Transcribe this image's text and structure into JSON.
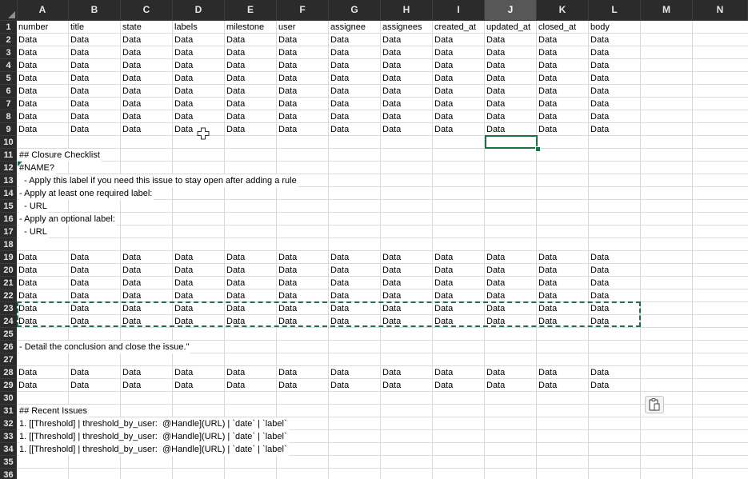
{
  "spreadsheet": {
    "columns": [
      "A",
      "B",
      "C",
      "D",
      "E",
      "F",
      "G",
      "H",
      "I",
      "J",
      "K",
      "L",
      "M",
      "N"
    ],
    "selected_column": "J",
    "selected_cell": "J10",
    "rows": [
      "1",
      "2",
      "3",
      "4",
      "5",
      "6",
      "7",
      "8",
      "9",
      "10",
      "11",
      "12",
      "13",
      "14",
      "15",
      "16",
      "17",
      "18",
      "19",
      "20",
      "21",
      "22",
      "23",
      "24",
      "25",
      "26",
      "27",
      "28",
      "29",
      "30",
      "31",
      "32",
      "33",
      "34",
      "35",
      "36"
    ],
    "headers": [
      "number",
      "title",
      "state",
      "labels",
      "milestone",
      "user",
      "assignee",
      "assignees",
      "created_at",
      "updated_at",
      "closed_at",
      "body"
    ],
    "data_cell": "Data",
    "notes": {
      "r11": "## Closure Checklist",
      "r12": "#NAME?",
      "r13": "  - Apply this label if you need this issue to stay open after adding a rule",
      "r14": "- Apply at least one required label:",
      "r15": "  - URL",
      "r16": "- Apply an optional label:",
      "r17": "  - URL",
      "r26": "- Detail the conclusion and close the issue.\"",
      "r31": "## Recent Issues",
      "r32": "1. [[Threshold] | threshold_by_user:  @Handle](URL) | `date` | `label`",
      "r33": "1. [[Threshold] | threshold_by_user:  @Handle](URL) | `date` | `label`",
      "r34": "1. [[Threshold] | threshold_by_user:  @Handle](URL) | `date` | `label`"
    },
    "icons": {
      "paste_options": "clipboard-icon",
      "cursor": "cell-cursor-icon",
      "select_all": "select-all-icon"
    },
    "colors": {
      "accent": "#1f7145",
      "header_bg": "#2b2b2b",
      "header_selected_bg": "#575757",
      "grid": "#dadada"
    }
  }
}
